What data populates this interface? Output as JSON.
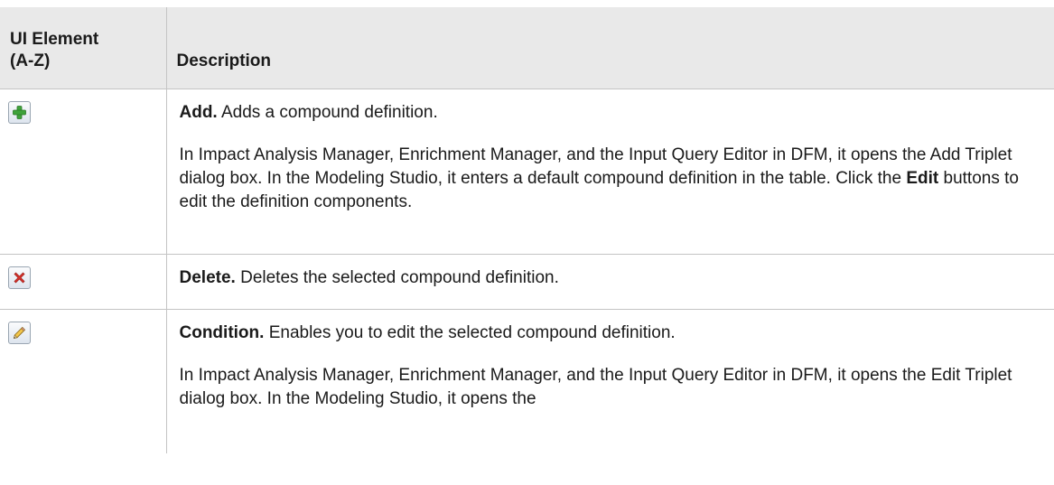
{
  "table": {
    "headers": {
      "ui_element_line1": "UI Element",
      "ui_element_line2": "(A-Z)",
      "description": "Description"
    },
    "rows": [
      {
        "icon": "add-icon",
        "title": "Add.",
        "summary": " Adds a compound definition.",
        "detail": "In Impact Analysis Manager, Enrichment Manager, and the Input Query Editor in DFM, it opens the Add Triplet dialog box. In the Modeling Studio, it enters a default compound definition in the table. Click the ",
        "detail_bold": "Edit",
        "detail_end": " buttons to edit the definition components."
      },
      {
        "icon": "delete-icon",
        "title": "Delete.",
        "summary": " Deletes the selected compound definition."
      },
      {
        "icon": "edit-pencil-icon",
        "title": "Condition.",
        "summary": " Enables you to edit the selected compound definition.",
        "detail": "In Impact Analysis Manager, Enrichment Manager, and the Input Query Editor in DFM, it opens the Edit Triplet dialog box. In the Modeling Studio, it opens the"
      }
    ]
  },
  "colors": {
    "header_bg": "#e9e9e9",
    "border": "#c4c4c4",
    "add_green": "#3fa33a",
    "delete_red": "#d8322c"
  }
}
